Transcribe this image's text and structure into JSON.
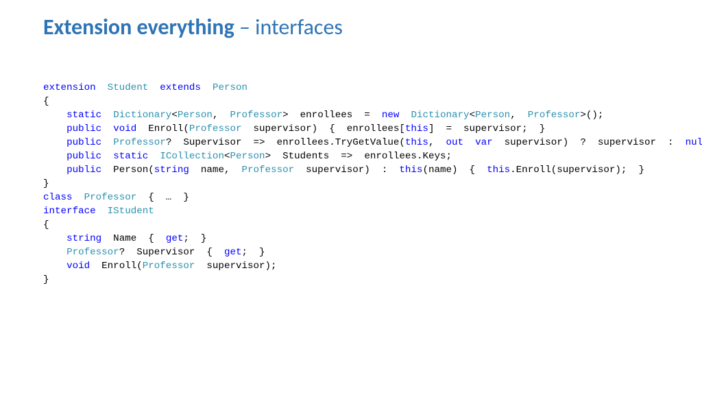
{
  "title": {
    "bold": "Extension everything",
    "sep": " – ",
    "light": "interfaces"
  },
  "code": {
    "tokens": [
      [
        [
          "kw",
          "extension"
        ],
        [
          "",
          "  "
        ],
        [
          "type",
          "Student"
        ],
        [
          "",
          "  "
        ],
        [
          "kw",
          "extends"
        ],
        [
          "",
          "  "
        ],
        [
          "type",
          "Person"
        ]
      ],
      [
        [
          "",
          "{"
        ]
      ],
      [
        [
          "",
          "    "
        ],
        [
          "kw",
          "static"
        ],
        [
          "",
          "  "
        ],
        [
          "type",
          "Dictionary"
        ],
        [
          "",
          "<"
        ],
        [
          "type",
          "Person"
        ],
        [
          "",
          ",  "
        ],
        [
          "type",
          "Professor"
        ],
        [
          "",
          ">  enrollees  =  "
        ],
        [
          "kw",
          "new"
        ],
        [
          "",
          "  "
        ],
        [
          "type",
          "Dictionary"
        ],
        [
          "",
          "<"
        ],
        [
          "type",
          "Person"
        ],
        [
          "",
          ",  "
        ],
        [
          "type",
          "Professor"
        ],
        [
          "",
          ">();"
        ]
      ],
      [
        [
          "",
          "    "
        ],
        [
          "kw",
          "public"
        ],
        [
          "",
          "  "
        ],
        [
          "kw",
          "void"
        ],
        [
          "",
          "  Enroll("
        ],
        [
          "type",
          "Professor"
        ],
        [
          "",
          "  supervisor)  {  enrollees["
        ],
        [
          "kw",
          "this"
        ],
        [
          "",
          "]  =  supervisor;  }"
        ]
      ],
      [
        [
          "",
          "    "
        ],
        [
          "kw",
          "public"
        ],
        [
          "",
          "  "
        ],
        [
          "type",
          "Professor"
        ],
        [
          "",
          "?  Supervisor  =>  enrollees.TryGetValue("
        ],
        [
          "kw",
          "this"
        ],
        [
          "",
          ",  "
        ],
        [
          "kw",
          "out"
        ],
        [
          "",
          "  "
        ],
        [
          "kw",
          "var"
        ],
        [
          "",
          "  supervisor)  ?  supervisor  :  "
        ],
        [
          "kw",
          "null"
        ],
        [
          "",
          ";"
        ]
      ],
      [
        [
          "",
          "    "
        ],
        [
          "kw",
          "public"
        ],
        [
          "",
          "  "
        ],
        [
          "kw",
          "static"
        ],
        [
          "",
          "  "
        ],
        [
          "type",
          "ICollection"
        ],
        [
          "",
          "<"
        ],
        [
          "type",
          "Person"
        ],
        [
          "",
          ">  Students  =>  enrollees.Keys;"
        ]
      ],
      [
        [
          "",
          "    "
        ],
        [
          "kw",
          "public"
        ],
        [
          "",
          "  Person("
        ],
        [
          "kw",
          "string"
        ],
        [
          "",
          "  name,  "
        ],
        [
          "type",
          "Professor"
        ],
        [
          "",
          "  supervisor)  :  "
        ],
        [
          "kw",
          "this"
        ],
        [
          "",
          "(name)  {  "
        ],
        [
          "kw",
          "this"
        ],
        [
          "",
          ".Enroll(supervisor);  }"
        ]
      ],
      [
        [
          "",
          "}"
        ]
      ],
      [
        [
          "",
          ""
        ]
      ],
      [
        [
          "kw",
          "class"
        ],
        [
          "",
          "  "
        ],
        [
          "type",
          "Professor"
        ],
        [
          "",
          "  {  …  }"
        ]
      ],
      [
        [
          "",
          ""
        ]
      ],
      [
        [
          "kw",
          "interface"
        ],
        [
          "",
          "  "
        ],
        [
          "type",
          "IStudent"
        ]
      ],
      [
        [
          "",
          "{"
        ]
      ],
      [
        [
          "",
          "    "
        ],
        [
          "kw",
          "string"
        ],
        [
          "",
          "  Name  {  "
        ],
        [
          "kw",
          "get"
        ],
        [
          "",
          ";  }"
        ]
      ],
      [
        [
          "",
          "    "
        ],
        [
          "type",
          "Professor"
        ],
        [
          "",
          "?  Supervisor  {  "
        ],
        [
          "kw",
          "get"
        ],
        [
          "",
          ";  }"
        ]
      ],
      [
        [
          "",
          "    "
        ],
        [
          "kw",
          "void"
        ],
        [
          "",
          "  Enroll("
        ],
        [
          "type",
          "Professor"
        ],
        [
          "",
          "  supervisor);"
        ]
      ],
      [
        [
          "",
          "}"
        ]
      ]
    ]
  }
}
